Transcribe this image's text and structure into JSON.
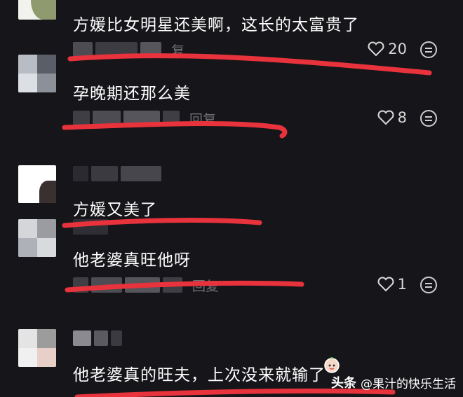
{
  "comments": [
    {
      "text": "方媛比女明星还美啊，这长的太富贵了",
      "reply": "复",
      "likes": "20"
    },
    {
      "text": "孕晚期还那么美",
      "reply": "回复",
      "likes": "8"
    },
    {
      "text": "方媛又美了",
      "reply": "",
      "likes": ""
    },
    {
      "text": "他老婆真旺他呀",
      "reply": "回复",
      "likes": "1"
    },
    {
      "text": "他老婆真的旺夫，上次没来就输了",
      "reply": "",
      "likes": ""
    }
  ],
  "watermark": {
    "brand": "头条",
    "account": "@果汁的快乐生活"
  },
  "colors": {
    "background": "#16161a",
    "underline": "#e8323c"
  }
}
